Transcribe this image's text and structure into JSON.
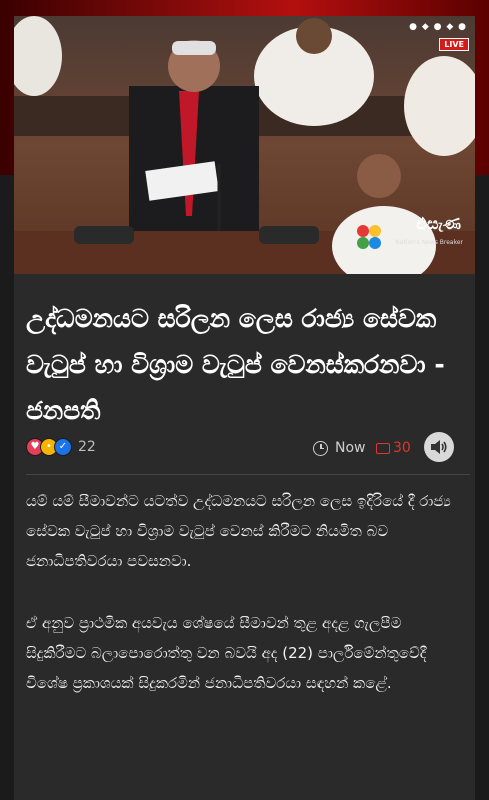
{
  "hero": {
    "live_label": "LIVE",
    "channel_name": "එසැණ",
    "channel_tagline": "Nation's News Breaker"
  },
  "article": {
    "headline": "උද්ධමනයට සරිලන ලෙස රාජ්‍ය සේවක වැටුප් හා විශ්‍රාම වැටුප් වෙනස්කරනවා - ජනපති",
    "reaction_count": "22",
    "time": "Now",
    "comment_count": "30",
    "paragraphs": [
      "යම් යම් සීමාවන්ට යටත්ව උද්ධමනයට සරිලන ලෙස ඉදිරියේ දී රාජ්‍ය සේවක වැටුප් හා විශ්‍රාම වැටුප් වෙනස් කිරීමට නියමිත බව ජනාධිපතිවරයා පවසනවා.",
      "ඒ අනුව ප්‍රාථමික අයවැය ශේෂයේ සීමාවන් තුළ අදළ ගැලපීම සිදුකිරීමට බලාපොරොත්තු වන බවයි අද (22) පාර්ලිමේන්තුවේදී විශේෂ ප්‍රකාශයක් සිදුකරමින් ජනාධිපතිවරයා සඳහන් කළේ."
    ]
  },
  "colors": {
    "accent_red": "#e0372b",
    "background": "#1b1b1b",
    "card": "#2a2a2a"
  },
  "icons": [
    "clock-icon",
    "comment-icon",
    "speaker-icon",
    "love-reaction-icon",
    "wow-reaction-icon",
    "like-reaction-icon"
  ]
}
